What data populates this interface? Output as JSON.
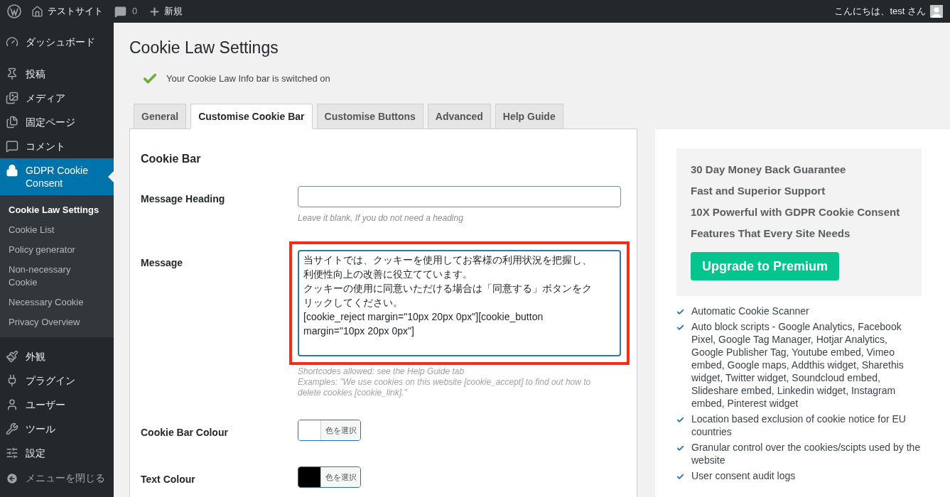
{
  "admin_bar": {
    "site_name": "テストサイト",
    "comments_count": "0",
    "new_label": "新規",
    "greeting": "こんにちは、test さん"
  },
  "sidebar": {
    "items": [
      {
        "label": "ダッシュボード",
        "selected": false
      },
      {
        "label": "投稿",
        "selected": false
      },
      {
        "label": "メディア",
        "selected": false
      },
      {
        "label": "固定ページ",
        "selected": false
      },
      {
        "label": "コメント",
        "selected": false
      },
      {
        "label": "GDPR Cookie Consent",
        "selected": true,
        "children": [
          {
            "label": "Cookie Law Settings",
            "selected": true
          },
          {
            "label": "Cookie List",
            "selected": false
          },
          {
            "label": "Policy generator",
            "selected": false
          },
          {
            "label": "Non-necessary Cookie",
            "selected": false
          },
          {
            "label": "Necessary Cookie",
            "selected": false
          },
          {
            "label": "Privacy Overview",
            "selected": false
          }
        ]
      },
      {
        "label": "外観",
        "selected": false
      },
      {
        "label": "プラグイン",
        "selected": false
      },
      {
        "label": "ユーザー",
        "selected": false
      },
      {
        "label": "ツール",
        "selected": false
      },
      {
        "label": "設定",
        "selected": false
      }
    ],
    "collapse_label": "メニューを閉じる"
  },
  "page_title": "Cookie Law Settings",
  "notice": "Your Cookie Law Info bar is switched on",
  "tabs": [
    {
      "label": "General",
      "selected": false
    },
    {
      "label": "Customise Cookie Bar",
      "selected": true
    },
    {
      "label": "Customise Buttons",
      "selected": false
    },
    {
      "label": "Advanced",
      "selected": false
    },
    {
      "label": "Help Guide",
      "selected": false
    }
  ],
  "section_title": "Cookie Bar",
  "fields": [
    {
      "kind": "text",
      "label": "Message Heading",
      "hint": "Leave it blank, If you do not need a heading"
    },
    {
      "kind": "textarea",
      "label": "Message",
      "highlighted": true,
      "lines": [
        "当サイトでは、クッキーを使用してお客様の利用状況を把握し、利便性向上の改善に役立てています。",
        "クッキーの使用に同意いただける場合は「同意する」ボタンをクリックしてください。",
        "[cookie_reject margin=\"10px 20px 0px\"][cookie_button margin=\"10px 20px 0px\"]"
      ],
      "hint": "Shortcodes allowed: see the Help Guide tab",
      "hint_2": "Examples: \"We use cookies on this website [cookie_accept] to find out how to delete cookies [cookie_link].\""
    },
    {
      "kind": "color",
      "label": "Cookie Bar Colour",
      "color": "#ffffff",
      "button": "色を選択"
    },
    {
      "kind": "color",
      "label": "Text Colour",
      "color": "#000000",
      "button": "色を選択"
    }
  ],
  "promo": {
    "headlines": [
      "30 Day Money Back Guarantee",
      "Fast and Superior Support",
      "10X Powerful with GDPR Cookie Consent",
      "Features That Every Site Needs"
    ],
    "button": "Upgrade to Premium",
    "features": [
      "Automatic Cookie Scanner",
      "Auto block scripts - Google Analytics, Facebook Pixel, Google Tag Manager, Hotjar Analytics, Google Publisher Tag, Youtube embed, Vimeo embed, Google maps, Addthis widget, Sharethis widget, Twitter widget, Soundcloud embed, Slideshare embed, Linkedin widget, Instagram embed, Pinterest widget",
      "Location based exclusion of cookie notice for EU countries",
      "Granular control over the cookies/scipts used by the website",
      "User consent audit logs"
    ]
  }
}
